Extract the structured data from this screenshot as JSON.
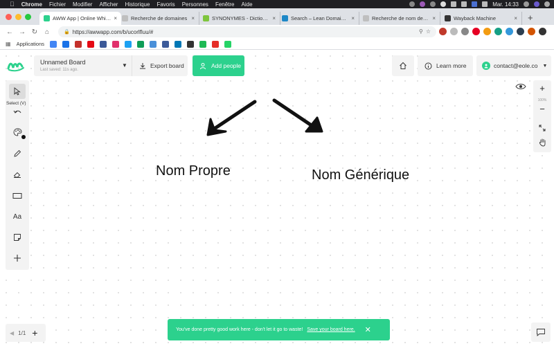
{
  "menubar": {
    "apple": "",
    "items": [
      "Chrome",
      "Fichier",
      "Modifier",
      "Afficher",
      "Historique",
      "Favoris",
      "Personnes",
      "Fenêtre",
      "Aide"
    ],
    "clock": "Mar. 14:33"
  },
  "tabs": [
    {
      "title": "AWW App | Online Whiteboard",
      "color": "#2cd18d",
      "active": true
    },
    {
      "title": "Recherche de domaines",
      "color": "#bfbfbf",
      "active": false
    },
    {
      "title": "SYNONYMES - Dictionnaire",
      "color": "#7ec53d",
      "active": false
    },
    {
      "title": "Search – Lean Domain Search",
      "color": "#1e88c7",
      "active": false
    },
    {
      "title": "Recherche de nom de domaine",
      "color": "#bfbfbf",
      "active": false
    },
    {
      "title": "Wayback Machine",
      "color": "#333333",
      "active": false
    }
  ],
  "address": {
    "url": "https://awwapp.com/b/ucorlfluu/#"
  },
  "bookmarks": {
    "apps_label": "Applications",
    "icons": [
      "#4285f4",
      "#1a73e8",
      "#c4302b",
      "#e50914",
      "#3b5998",
      "#e1306c",
      "#1da1f2",
      "#0f9d58",
      "#4a90d9",
      "#3c5a99",
      "#0077b5",
      "#333333",
      "#1db954",
      "#e52d27",
      "#25d366"
    ]
  },
  "app": {
    "board": {
      "name": "Unnamed Board",
      "saved": "Last saved: 11s ago."
    },
    "export_label": "Export board",
    "add_people_label": "Add people",
    "learn_more_label": "Learn more",
    "account_email": "contact@eole.co",
    "tooltip": "Select (V)",
    "text_tool": "Aa",
    "zoom": "100%",
    "canvas": {
      "left_text": "Nom Propre",
      "right_text": "Nom Générique"
    },
    "pager": {
      "page": "1/1"
    },
    "toast": {
      "message": "You've done pretty good work here - don't let it go to waste!",
      "link": "Save your board here."
    }
  },
  "colors": {
    "brand": "#2cd18d",
    "toolbar_bg": "#f3f3f3"
  }
}
